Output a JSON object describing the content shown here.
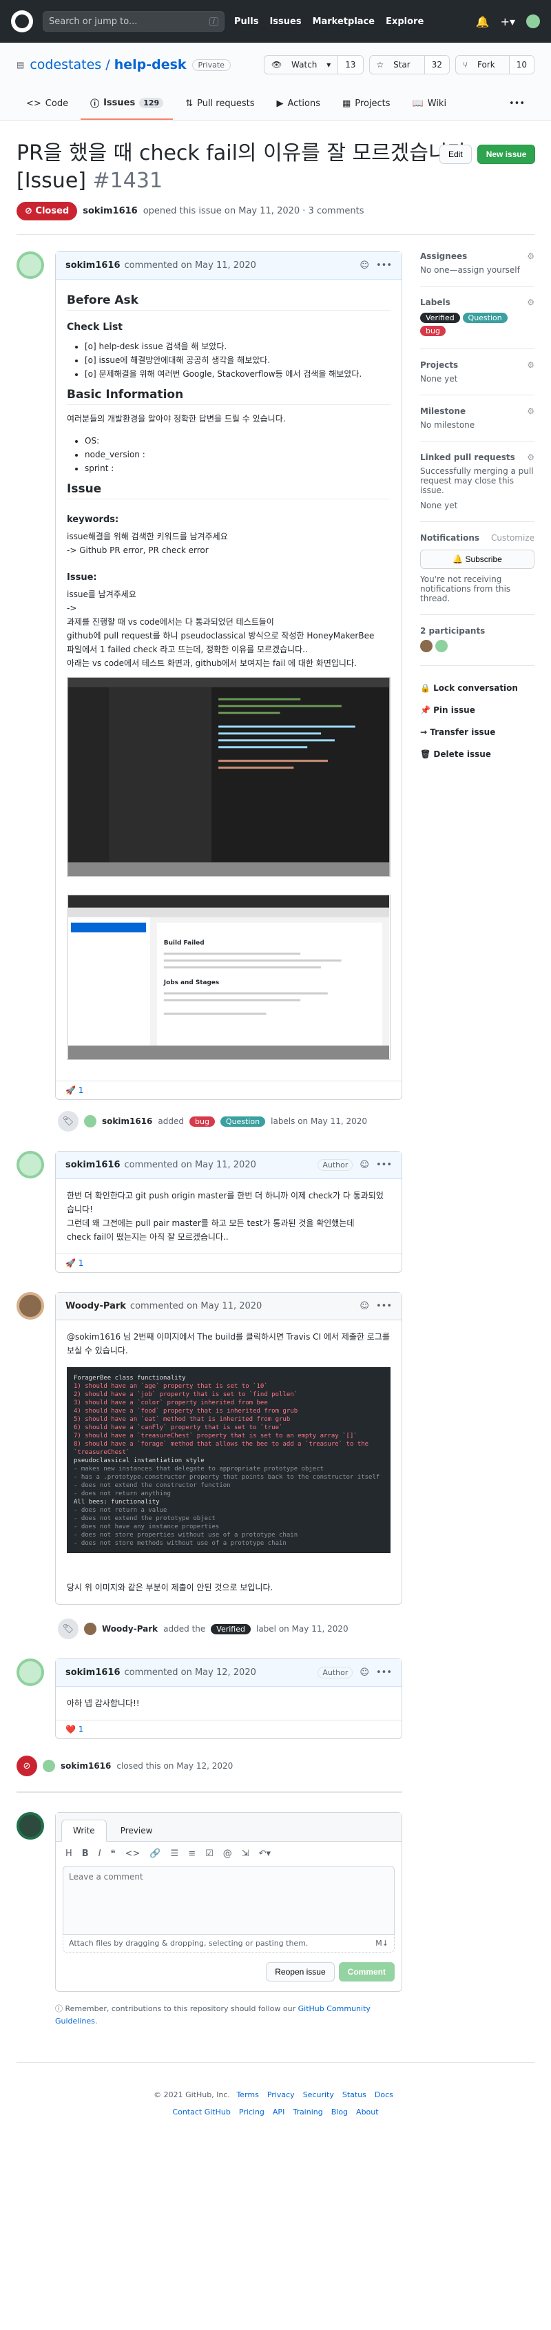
{
  "header": {
    "search_placeholder": "Search or jump to...",
    "slash": "/",
    "nav": [
      "Pulls",
      "Issues",
      "Marketplace",
      "Explore"
    ]
  },
  "repo": {
    "owner": "codestates",
    "sep": "/",
    "name": "help-desk",
    "visibility": "Private",
    "watch": "Watch",
    "watch_count": "13",
    "star": "Star",
    "star_count": "32",
    "fork": "Fork",
    "fork_count": "10"
  },
  "tabs": [
    {
      "label": "Code"
    },
    {
      "label": "Issues",
      "count": "129"
    },
    {
      "label": "Pull requests"
    },
    {
      "label": "Actions"
    },
    {
      "label": "Projects"
    },
    {
      "label": "Wiki"
    }
  ],
  "issue": {
    "title": "PR을 했을 때 check fail의 이유를 잘 모르겠습니다[Issue]",
    "number": "#1431",
    "edit": "Edit",
    "new_issue": "New issue",
    "state": "Closed",
    "author": "sokim1616",
    "meta": "opened this issue on May 11, 2020 · 3 comments"
  },
  "c1": {
    "author": "sokim1616",
    "when": "commented on May 11, 2020",
    "h_before": "Before Ask",
    "h_check": "Check List",
    "checks": [
      "[o] help-desk issue 검색을 해 보았다.",
      "[o] issue에 해결방안에대해 공공히 생각을 해보았다.",
      "[o] 문제해결을 위해 여러번 Google, Stackoverflow등 에서 검색을 해보았다."
    ],
    "h_basic": "Basic Information",
    "basic_text": "여러분들의 개발환경을 알아야 정확한 답변을 드릴 수 있습니다.",
    "basic_list": [
      "OS:",
      "node_version :",
      "sprint :"
    ],
    "h_issue": "Issue",
    "kw_label": "keywords:",
    "kw1": "issue해결을 위해 검색한 키워드를 남겨주세요",
    "kw2": "-> Github PR error, PR check error",
    "issue_label": "Issue:",
    "i1": "issue를 남겨주세요",
    "i2": "->",
    "i3": "과제를 진행할 때 vs code에서는 다 통과되었던 테스트들이",
    "i4": "github에 pull request를 하니 pseudoclassical 방식으로 작성한 HoneyMakerBee",
    "i5": "파일에서 1 failed check 라고 뜨는데, 정확한 이유를 모르겠습니다..",
    "i6": "아래는 vs code에서 테스트 화면과, github에서 보여지는 fail 에 대한 화면입니다.",
    "shot_title": "Build Failed",
    "shot_sub": "Jobs and Stages",
    "reaction": "🚀 1"
  },
  "e1": {
    "actor": "sokim1616",
    "text1": "added",
    "labels": [
      "bug",
      "Question"
    ],
    "text2": "labels on May 11, 2020"
  },
  "c2": {
    "author": "sokim1616",
    "when": "commented on May 11, 2020",
    "badge": "Author",
    "l1": "한번 더 확인한다고 git push origin master를 한번 더 하니까 이제 check가 다 통과되었습니다!",
    "l2": "그런데 왜 그전에는 pull pair master를 하고 모든 test가 통과된 것을 확인했는데",
    "l3": "check fail이 떴는지는 아직 잘 모르겠습니다..",
    "reaction": "🚀 1"
  },
  "c3": {
    "author": "Woody-Park",
    "when": "commented on May 11, 2020",
    "l1": "@sokim1616 님 2번째 이미지에서 The build를 클릭하시면 Travis CI 에서 제출한 로그를 보실 수 있습니다.",
    "code": [
      "ForagerBee class functionality",
      "  1) should have an `age` property that is set to `10`",
      "  2) should have a `job` property that is set to `find pollen`",
      "  3) should have a `color` property inherited from bee",
      "  4) should have a `food` property that is inherited from grub",
      "  5) should have an `eat` method that is inherited from grub",
      "  6) should have a `canFly` property that is set to `true`",
      "  7) should have a `treasureChest` property that is set to an empty array `[]`",
      "  8) should have a `forage` method that allows the bee to add a `treasure` to the `treasureChest`",
      "pseudoclassical instantiation style",
      "  - makes new instances that delegate to appropriate prototype object",
      "  - has a .prototype.constructor property that points back to the constructor itself",
      "  - does not extend the constructor function",
      "  - does not return anything",
      "All bees: functionality",
      "  - does not return a value",
      "  - does not extend the prototype object",
      "  - does not have any instance properties",
      "  - does not store properties without use of a prototype chain",
      "  - does not store methods without use of a prototype chain"
    ],
    "l2": "당시 위 이미지와 같은 부분이 제출이 안된 것으로 보입니다."
  },
  "e2": {
    "actor": "Woody-Park",
    "text1": "added the",
    "label": "Verified",
    "text2": "label on May 11, 2020"
  },
  "c4": {
    "author": "sokim1616",
    "when": "commented on May 12, 2020",
    "badge": "Author",
    "text": "아하 넵 감사합니다!!",
    "reaction": "❤️ 1"
  },
  "e3": {
    "actor": "sokim1616",
    "text": "closed this on May 12, 2020"
  },
  "editor": {
    "write": "Write",
    "preview": "Preview",
    "placeholder": "Leave a comment",
    "attach": "Attach files by dragging & dropping, selecting or pasting them.",
    "reopen": "Reopen issue",
    "comment": "Comment"
  },
  "guidelines": {
    "pre": "Remember, contributions to this repository should follow our",
    "link": "GitHub Community Guidelines",
    "post": "."
  },
  "sidebar": {
    "assignees": "Assignees",
    "assignees_v": "No one—assign yourself",
    "labels": "Labels",
    "labels_list": [
      "Verified",
      "Question",
      "bug"
    ],
    "projects": "Projects",
    "projects_v": "None yet",
    "milestone": "Milestone",
    "milestone_v": "No milestone",
    "linked": "Linked pull requests",
    "linked_t": "Successfully merging a pull request may close this issue.",
    "linked_v": "None yet",
    "notif": "Notifications",
    "customize": "Customize",
    "subscribe": "Subscribe",
    "notif_t": "You're not receiving notifications from this thread.",
    "participants": "2 participants",
    "actions": [
      "Lock conversation",
      "Pin issue",
      "Transfer issue",
      "Delete issue"
    ]
  },
  "footer": {
    "copy": "© 2021 GitHub, Inc.",
    "links1": [
      "Terms",
      "Privacy",
      "Security",
      "Status",
      "Docs"
    ],
    "links2": [
      "Contact GitHub",
      "Pricing",
      "API",
      "Training",
      "Blog",
      "About"
    ]
  },
  "colors": {
    "closed": "#cb2431",
    "verified": "#24292e",
    "question": "#3aa0a0",
    "bug": "#d73a4a"
  }
}
